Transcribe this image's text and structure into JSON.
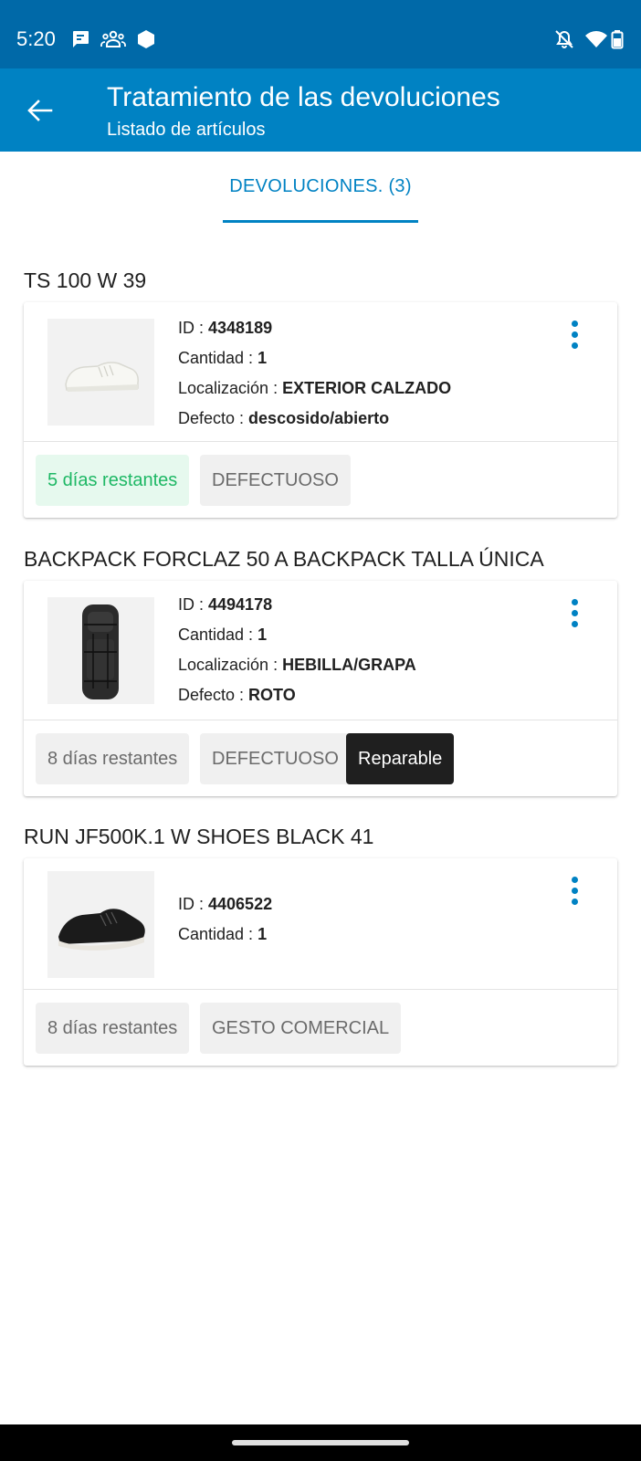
{
  "status_bar": {
    "time": "5:20",
    "left_icons": [
      "chat-icon",
      "groups-icon",
      "hexagon-icon"
    ],
    "right_icons": [
      "notifications-off-icon",
      "wifi-icon",
      "battery-icon"
    ],
    "background": "#0069A8"
  },
  "app_bar": {
    "title": "Tratamiento de las devoluciones",
    "subtitle": "Listado de artículos",
    "background": "#0082C3"
  },
  "tabs": [
    {
      "label": "DEVOLUCIONES. (3)",
      "selected": true
    }
  ],
  "items": [
    {
      "title": "TS 100 W 39",
      "image": "white-sneaker",
      "details": [
        {
          "label": "ID : ",
          "value": "4348189"
        },
        {
          "label": "Cantidad : ",
          "value": "1"
        },
        {
          "label": "Localización : ",
          "value": "EXTERIOR CALZADO"
        },
        {
          "label": "Defecto : ",
          "value": "descosido/abierto"
        }
      ],
      "chips": [
        {
          "text": "5 días restantes",
          "style": "green"
        },
        {
          "text": "DEFECTUOSO",
          "style": "grey"
        }
      ]
    },
    {
      "title": "BACKPACK FORCLAZ 50 A BACKPACK TALLA ÚNICA",
      "image": "black-backpack",
      "details": [
        {
          "label": "ID : ",
          "value": "4494178"
        },
        {
          "label": "Cantidad : ",
          "value": "1"
        },
        {
          "label": "Localización : ",
          "value": "HEBILLA/GRAPA"
        },
        {
          "label": "Defecto : ",
          "value": "ROTO"
        }
      ],
      "chips": [
        {
          "text": "8 días restantes",
          "style": "grey"
        },
        {
          "text": "DEFECTUOSO",
          "style": "grey"
        },
        {
          "text": "Reparable",
          "style": "dark"
        }
      ]
    },
    {
      "title": "RUN JF500K.1 W SHOES BLACK 41",
      "image": "black-running-shoe",
      "details": [
        {
          "label": "ID : ",
          "value": "4406522"
        },
        {
          "label": "Cantidad : ",
          "value": "1"
        }
      ],
      "chips": [
        {
          "text": "8 días restantes",
          "style": "grey"
        },
        {
          "text": "GESTO COMERCIAL",
          "style": "grey"
        }
      ]
    }
  ],
  "colors": {
    "accent": "#0082C3",
    "chip_green_text": "#1EB865",
    "chip_green_bg": "#E6F9EE",
    "chip_grey_bg": "#F0F0F0",
    "chip_dark_bg": "#1F1F1F"
  }
}
